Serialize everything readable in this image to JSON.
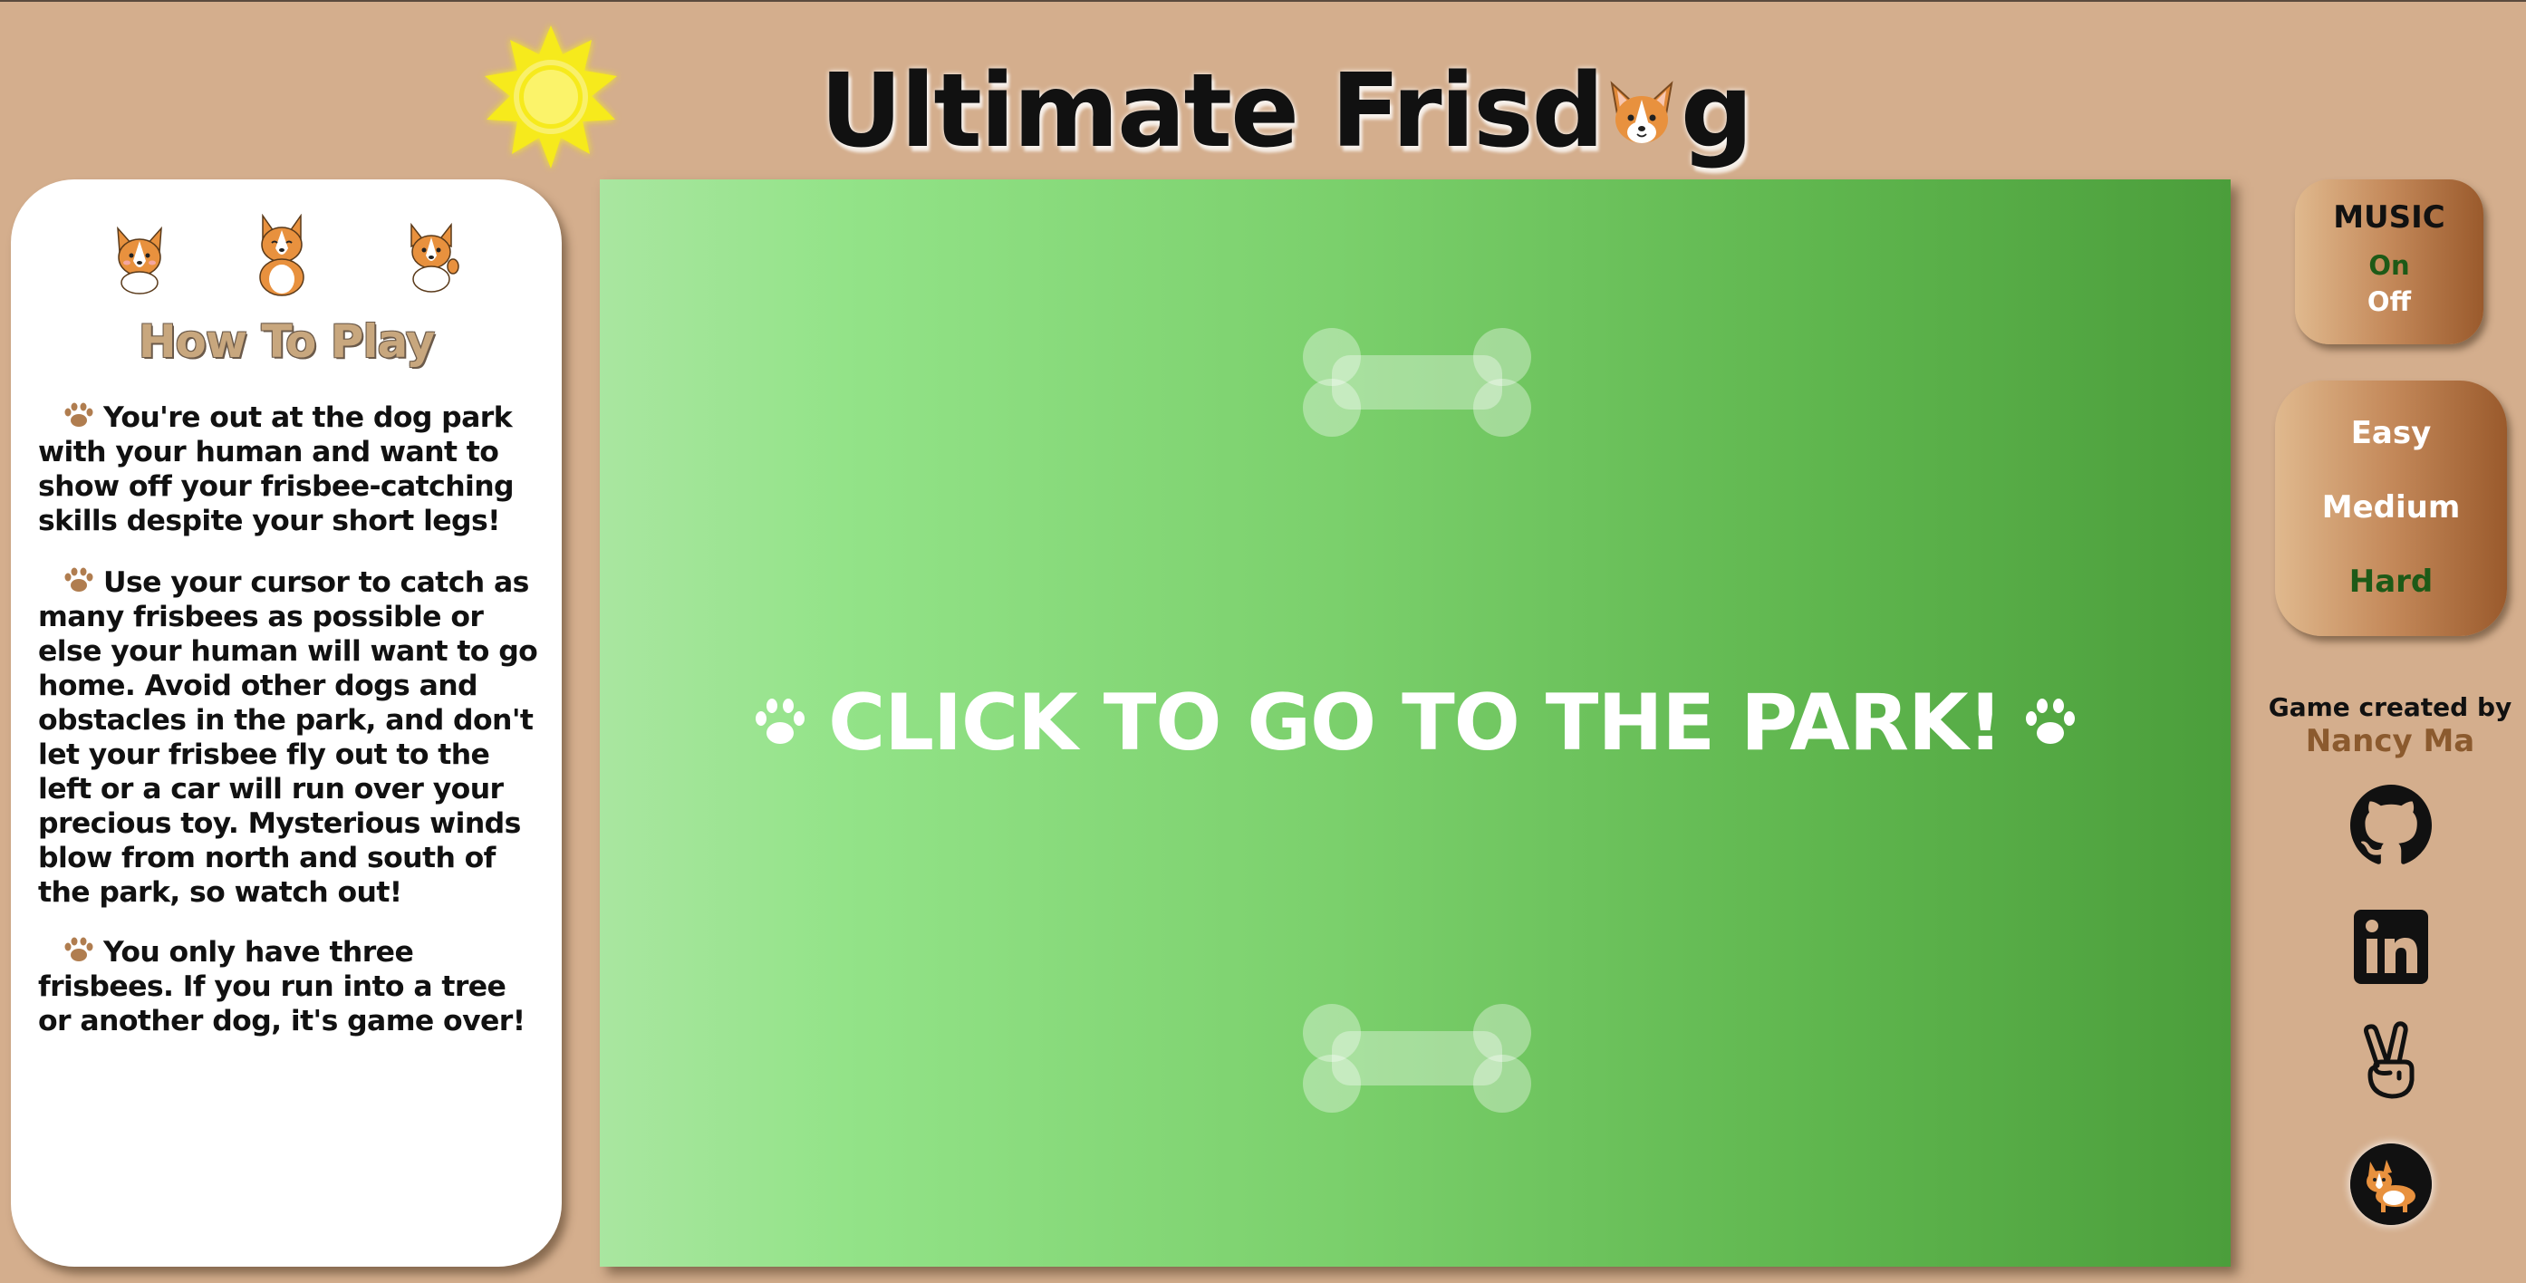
{
  "title": {
    "before": "Ultimate Frisd",
    "after": "g"
  },
  "instructions": {
    "heading": "How To Play",
    "paragraphs": [
      "You're out at the dog park with your human and want to show off your frisbee-catching skills despite your short legs!",
      "Use your cursor to catch as many frisbees as possible or else your human will want to go home. Avoid other dogs and obstacles in the park, and don't let your frisbee fly out to the left or a car will run over your precious toy. Mysterious winds blow from north and south of the park, so watch out!",
      "You only have three frisbees. If you run into a tree or another dog, it's game over!"
    ]
  },
  "game": {
    "start_prompt": "CLICK TO GO TO THE PARK!"
  },
  "music": {
    "label": "MUSIC",
    "on": "On",
    "off": "Off",
    "selected": "On"
  },
  "difficulty": {
    "options": [
      "Easy",
      "Medium",
      "Hard"
    ],
    "selected": "Hard"
  },
  "credits": {
    "label": "Game created by",
    "author": "Nancy Ma"
  },
  "social_icons": [
    "github-icon",
    "linkedin-icon",
    "peace-hand-icon",
    "corgi-avatar-icon"
  ],
  "colors": {
    "background": "#d4ae8d",
    "selected_option": "#1d5a17",
    "author_name": "#8b5a2e",
    "heading": "#c8a77e"
  }
}
